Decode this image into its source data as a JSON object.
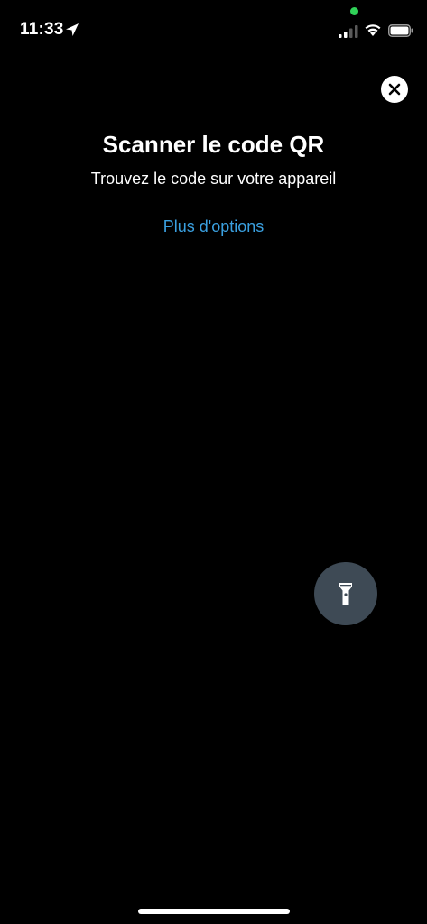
{
  "status_bar": {
    "time": "11:33",
    "icons": [
      "location-arrow-icon",
      "signal-icon",
      "wifi-icon",
      "battery-icon"
    ],
    "privacy_dot_color": "#30d158"
  },
  "scanner": {
    "title": "Scanner le code QR",
    "subtitle": "Trouvez le code sur votre appareil",
    "more_options_label": "Plus d'options",
    "link_color": "#3aa0e0"
  },
  "controls": {
    "close_icon": "close-icon",
    "flashlight_icon": "flashlight-icon"
  }
}
